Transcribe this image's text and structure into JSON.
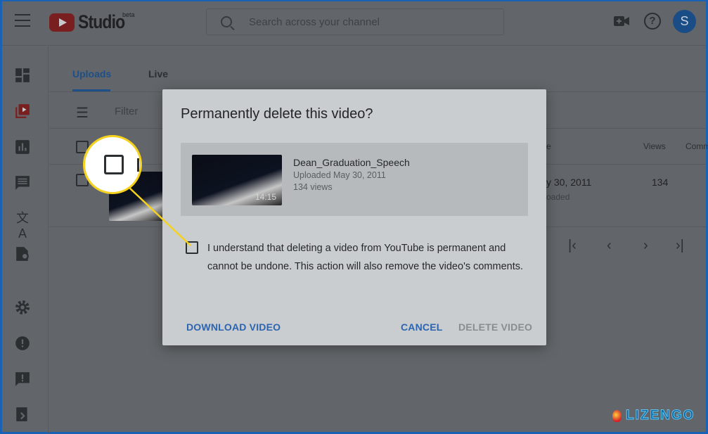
{
  "header": {
    "logo_text": "Studio",
    "logo_badge": "beta",
    "search_placeholder": "Search across your channel",
    "avatar_letter": "S",
    "help_glyph": "?"
  },
  "sidebar": {
    "items": [
      {
        "icon": "dashboard-icon"
      },
      {
        "icon": "videos-icon",
        "active": true
      },
      {
        "icon": "analytics-icon"
      },
      {
        "icon": "comments-icon"
      },
      {
        "icon": "translate-icon"
      },
      {
        "icon": "copyright-icon"
      },
      {
        "icon": "settings-icon"
      },
      {
        "icon": "feedback-icon"
      },
      {
        "icon": "report-icon"
      },
      {
        "icon": "exit-icon"
      }
    ]
  },
  "main": {
    "tabs": [
      {
        "label": "Uploads",
        "active": true
      },
      {
        "label": "Live"
      }
    ],
    "filter_label": "Filter",
    "columns": {
      "date": "e",
      "views": "Views",
      "comments": "Comm"
    },
    "row": {
      "date": "y 30, 2011",
      "status": "oaded",
      "views": "134"
    }
  },
  "dialog": {
    "title": "Permanently delete this video?",
    "video": {
      "name": "Dean_Graduation_Speech",
      "uploaded": "Uploaded May 30, 2011",
      "views": "134 views",
      "duration": "14:15"
    },
    "checkbox_label": "I understand that deleting a video from YouTube is permanent and cannot be undone. This action will also remove the video's comments.",
    "checkbox_checked": false,
    "download_label": "DOWNLOAD VIDEO",
    "cancel_label": "CANCEL",
    "delete_label": "DELETE VIDEO"
  },
  "colors": {
    "accent": "#1e4f86",
    "dialog_button": "#2d64b0",
    "disabled": "#8a8d90",
    "callout_ring": "#f5d21e",
    "frame": "#1a63b4"
  },
  "watermark": {
    "text": "LIZENGO"
  }
}
